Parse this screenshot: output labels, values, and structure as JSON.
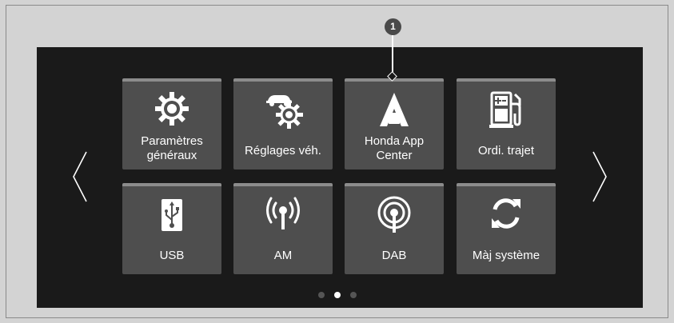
{
  "callout": {
    "number": "1"
  },
  "menu": {
    "row1": [
      {
        "label_lines": [
          "Paramètres",
          "généraux"
        ],
        "icon": "gear-icon"
      },
      {
        "label_lines": [
          "Réglages véh."
        ],
        "icon": "car-gear-icon"
      },
      {
        "label_lines": [
          "Honda App",
          "Center"
        ],
        "icon": "app-center-icon"
      },
      {
        "label_lines": [
          "Ordi. trajet"
        ],
        "icon": "fuel-pump-icon"
      }
    ],
    "row2": [
      {
        "label_lines": [
          "USB"
        ],
        "icon": "usb-icon"
      },
      {
        "label_lines": [
          "AM"
        ],
        "icon": "am-radio-icon"
      },
      {
        "label_lines": [
          "DAB"
        ],
        "icon": "dab-radio-icon"
      },
      {
        "label_lines": [
          "Màj système"
        ],
        "icon": "sync-icon"
      }
    ]
  },
  "navigation": {
    "prev": "previous-page-arrow",
    "next": "next-page-arrow"
  },
  "pagination": {
    "pages": 3,
    "current": 2
  },
  "colors": {
    "screen_bg": "#1a1a1a",
    "tile_bg": "#4e4e4e",
    "tile_top": "#8c8c8c",
    "page_bg": "#d3d3d3"
  }
}
